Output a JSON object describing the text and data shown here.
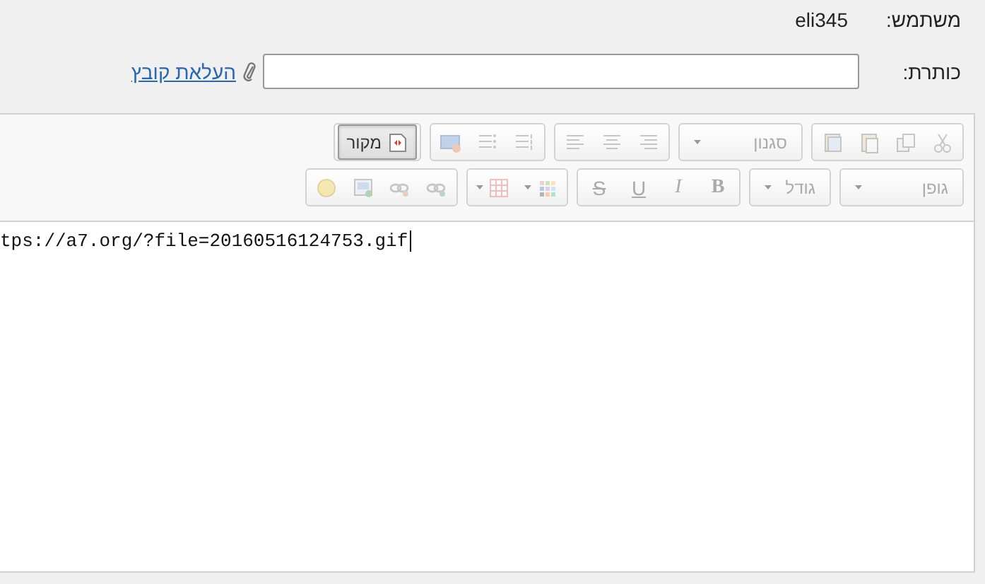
{
  "user": {
    "label": "משתמש:",
    "value": "eli345"
  },
  "title_field": {
    "label": "כותרת:"
  },
  "attach": {
    "label": "העלאת קובץ"
  },
  "toolbar": {
    "rows": [
      [
        {
          "items": [
            {
              "kind": "cut",
              "disabled": true
            },
            {
              "kind": "copy",
              "disabled": true
            },
            {
              "kind": "paste",
              "disabled": true
            },
            {
              "kind": "paste-word",
              "disabled": true
            }
          ]
        },
        {
          "items": [
            {
              "kind": "combo",
              "label": "סגנון",
              "disabled": true
            }
          ]
        },
        {
          "items": [
            {
              "kind": "align-right",
              "disabled": true
            },
            {
              "kind": "align-center",
              "disabled": true
            },
            {
              "kind": "align-left",
              "disabled": true
            }
          ]
        },
        {
          "items": [
            {
              "kind": "numbered-list",
              "disabled": true
            },
            {
              "kind": "bulleted-list",
              "disabled": true
            },
            {
              "kind": "image",
              "disabled": true
            }
          ]
        },
        {
          "items": [
            {
              "kind": "source",
              "label": "מקור",
              "disabled": false
            }
          ]
        }
      ],
      [
        {
          "items": [
            {
              "kind": "combo",
              "label": "גופן",
              "disabled": true
            }
          ]
        },
        {
          "items": [
            {
              "kind": "combo",
              "label": "גודל",
              "disabled": true
            }
          ]
        },
        {
          "items": [
            {
              "kind": "letter",
              "label": "B",
              "disabled": true
            },
            {
              "kind": "letter",
              "label": "I",
              "disabled": true
            },
            {
              "kind": "letter",
              "label": "U",
              "disabled": true
            },
            {
              "kind": "letter",
              "label": "S",
              "disabled": true
            }
          ]
        },
        {
          "items": [
            {
              "kind": "color",
              "disabled": true
            },
            {
              "kind": "table",
              "disabled": true
            }
          ]
        },
        {
          "items": [
            {
              "kind": "link",
              "disabled": true
            },
            {
              "kind": "unlink",
              "disabled": true
            },
            {
              "kind": "media",
              "disabled": true
            },
            {
              "kind": "smiley",
              "disabled": true
            }
          ]
        }
      ]
    ]
  },
  "content": {
    "text": "tps://a7.org/?file=20160516124753.gif"
  }
}
